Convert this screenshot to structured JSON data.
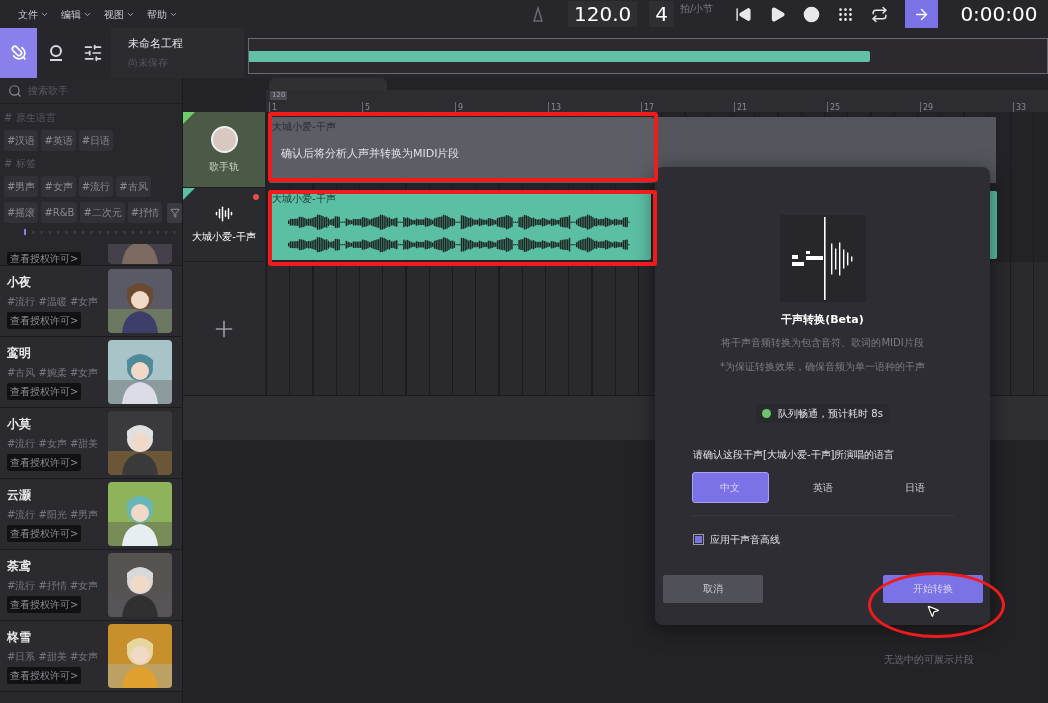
{
  "menu": [
    {
      "label": "文件"
    },
    {
      "label": "编辑"
    },
    {
      "label": "视图"
    },
    {
      "label": "帮助"
    }
  ],
  "transport": {
    "tempo": "120.0",
    "beats": "4",
    "beats_unit": "拍/小节",
    "time": "0:00:00",
    "buttons": [
      {
        "kind": "skip_back",
        "active": false
      },
      {
        "kind": "play",
        "active": false
      },
      {
        "kind": "record",
        "active": false
      },
      {
        "kind": "snap",
        "active": false
      },
      {
        "kind": "loop",
        "active": false
      },
      {
        "kind": "follow",
        "active": true
      }
    ]
  },
  "nav": [
    {
      "kind": "singer",
      "selected": true
    },
    {
      "kind": "user",
      "selected": false
    },
    {
      "kind": "mixer",
      "selected": false
    }
  ],
  "project": {
    "title": "未命名工程",
    "status": "尚未保存"
  },
  "sidebar": {
    "search": {
      "placeholder": "搜索歌手"
    },
    "tag_groups": [
      {
        "title": "# 原生语言",
        "rows": [
          [
            "#汉语",
            "#英语",
            "#日语"
          ]
        ]
      },
      {
        "title": "# 标签",
        "rows": [
          [
            "#男声",
            "#女声",
            "#流行",
            "#古风"
          ],
          [
            "#摇滚",
            "#R&B",
            "#二次元",
            "#抒情"
          ]
        ]
      }
    ],
    "singers": [
      {
        "kind": "partial",
        "license": "查看授权许可>"
      },
      {
        "kind": "full",
        "name": "小夜",
        "tags": "#流行 #温暖 #女声",
        "license": "查看授权许可>"
      },
      {
        "kind": "full",
        "name": "鸾明",
        "tags": "#古风 #婉柔 #女声",
        "license": "查看授权许可>"
      },
      {
        "kind": "full",
        "name": "小莫",
        "tags": "#流行 #女声 #甜美",
        "license": "查看授权许可>"
      },
      {
        "kind": "full",
        "name": "云灏",
        "tags": "#流行 #阳光 #男声",
        "license": "查看授权许可>"
      },
      {
        "kind": "full",
        "name": "荼鸢",
        "tags": "#流行 #抒情 #女声",
        "license": "查看授权许可>"
      },
      {
        "kind": "full",
        "name": "柊雪",
        "tags": "#日系 #甜美 #女声",
        "license": "查看授权许可>"
      }
    ]
  },
  "tracks": [
    {
      "kind": "singer",
      "name": "歌手轨",
      "armed": false
    },
    {
      "kind": "audio",
      "name": "大城小爱-干声",
      "armed": true
    }
  ],
  "timeline": {
    "tempo_marker": "120",
    "bars": [
      "1",
      "5",
      "9",
      "13",
      "17",
      "21",
      "25",
      "29",
      "33"
    ],
    "clips": [
      {
        "kind": "midi",
        "name": "大城小爱-干声",
        "message": "确认后将分析人声并转换为MIDI片段"
      },
      {
        "kind": "audio",
        "name": "大城小爱-干声"
      }
    ]
  },
  "dialog": {
    "title": "干声转换(Beta)",
    "description": "将干声音频转换为包含音符、歌词的MIDI片段",
    "note": "*为保证转换效果，确保音频为单一语种的干声",
    "status": "队列畅通，预计耗时 8s",
    "question": "请确认这段干声[大城小爱-干声]所演唱的语言",
    "options": [
      {
        "label": "中文",
        "selected": true
      },
      {
        "label": "英语",
        "selected": false
      },
      {
        "label": "日语",
        "selected": false
      }
    ],
    "pitch_line": {
      "label": "应用干声音高线",
      "checked": true
    },
    "buttons": [
      {
        "kind": "cancel",
        "label": "取消"
      },
      {
        "kind": "primary",
        "label": "开始转换"
      }
    ]
  },
  "footer": "无选中的可展示片段",
  "annotations": [
    {
      "kind": "rectangle"
    },
    {
      "kind": "rectangle"
    },
    {
      "kind": "ellipse"
    }
  ]
}
